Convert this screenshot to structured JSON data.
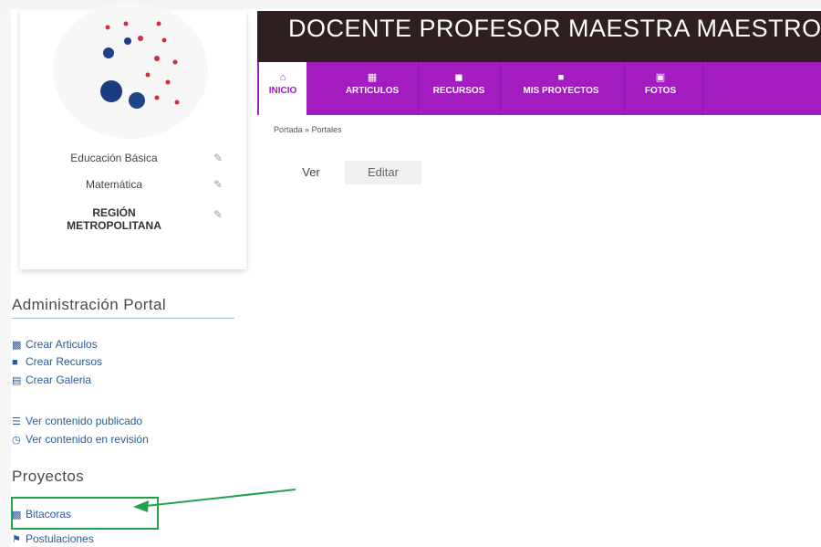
{
  "profile": {
    "items": [
      {
        "label": "Educación Básica"
      },
      {
        "label": "Matemática"
      },
      {
        "label": "REGIÓN\nMETROPOLITANA"
      }
    ]
  },
  "header": {
    "title": "DOCENTE PROFESOR MAESTRA MAESTRO",
    "bg_color": "#2f1f21",
    "nav_color": "#a21cc0"
  },
  "nav": {
    "items": [
      {
        "label": "INICIO",
        "icon": "home-icon",
        "active": true
      },
      {
        "label": "ARTICULOS",
        "icon": "article-icon"
      },
      {
        "label": "RECURSOS",
        "icon": "briefcase-icon"
      },
      {
        "label": "MIS PROYECTOS",
        "icon": "folder-icon"
      },
      {
        "label": "FOTOS",
        "icon": "photos-icon"
      }
    ]
  },
  "breadcrumb": "Portada » Portales",
  "tabs": {
    "view": "Ver",
    "edit": "Editar"
  },
  "admin": {
    "title": "Administración Portal",
    "links": [
      {
        "label": "Crear Articulos",
        "icon": "book-icon"
      },
      {
        "label": "Crear Recursos",
        "icon": "resource-icon"
      },
      {
        "label": "Crear Galeria",
        "icon": "gallery-icon"
      },
      {
        "label": "Ver contenido publicado",
        "icon": "list-icon"
      },
      {
        "label": "Ver contenido en revisión",
        "icon": "clock-icon"
      }
    ]
  },
  "projects": {
    "title": "Proyectos",
    "links": [
      {
        "label": "Bitacoras",
        "icon": "book-icon"
      },
      {
        "label": "Postulaciones",
        "icon": "flag-icon"
      }
    ]
  },
  "annotation": {
    "color": "#22a34a"
  }
}
